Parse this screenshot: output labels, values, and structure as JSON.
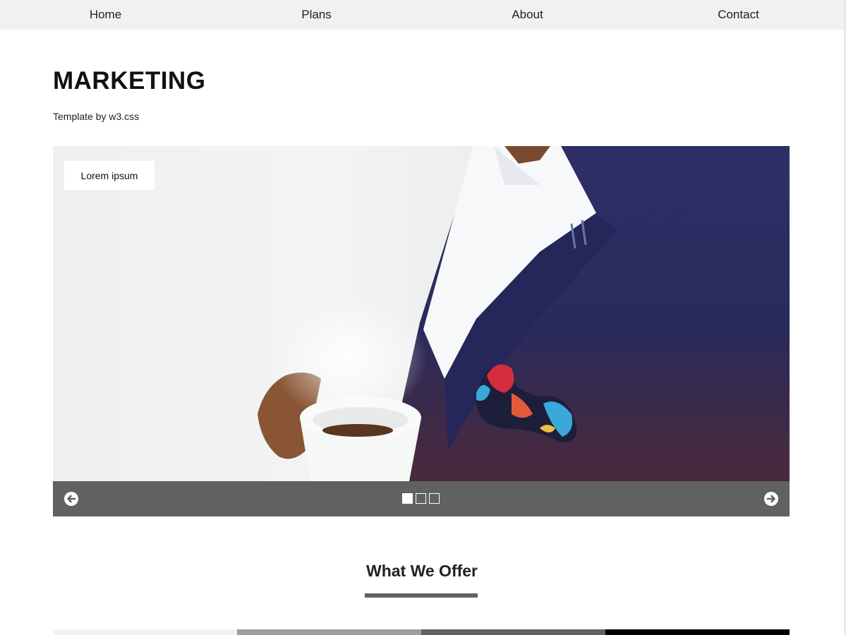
{
  "nav": {
    "items": [
      {
        "label": "Home"
      },
      {
        "label": "Plans"
      },
      {
        "label": "About"
      },
      {
        "label": "Contact"
      }
    ]
  },
  "header": {
    "title": "MARKETING",
    "subtitle": "Template by w3.css"
  },
  "slideshow": {
    "caption": "Lorem ipsum",
    "slide_count": 3,
    "active_slide": 1,
    "prev_icon": "arrow-circle-left-icon",
    "next_icon": "arrow-circle-right-icon"
  },
  "offer": {
    "heading": "What We Offer"
  },
  "colors": {
    "nav_bg": "#f1f1f1",
    "controls_bg": "#616161",
    "underline": "#616161",
    "strip": [
      "#f1f1f1",
      "#9e9e9e",
      "#616161",
      "#000000"
    ]
  }
}
